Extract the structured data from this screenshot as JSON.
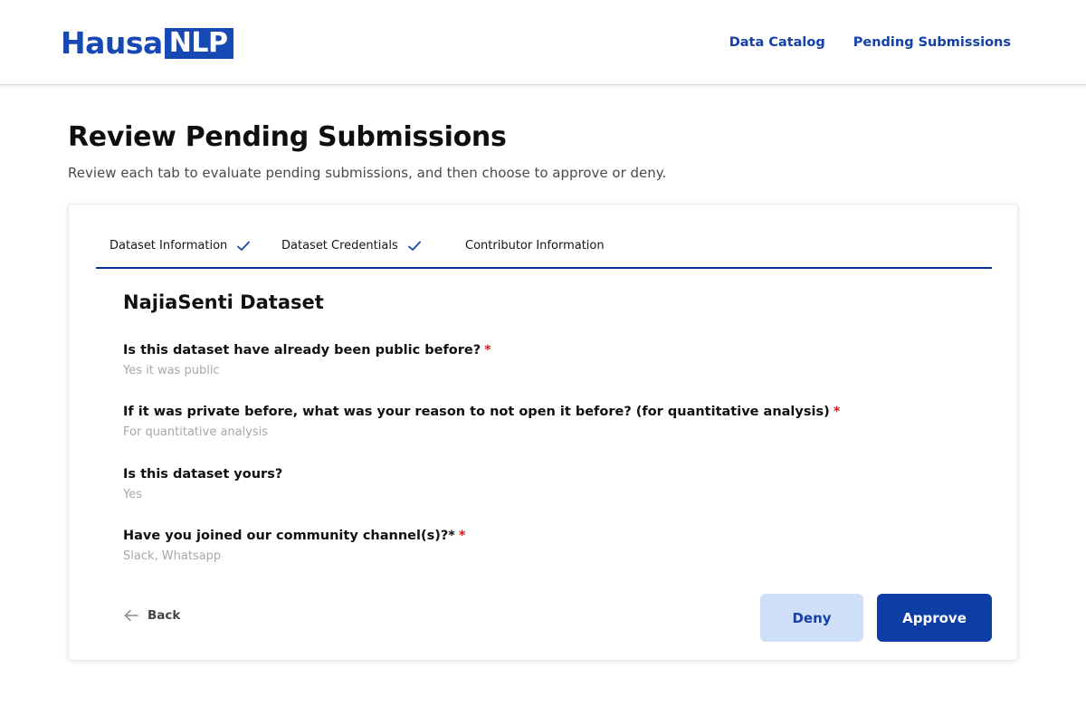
{
  "header": {
    "logo": {
      "part1": "Hausa",
      "part2": "NLP"
    },
    "nav": [
      {
        "label": "Data Catalog"
      },
      {
        "label": "Pending Submissions"
      }
    ]
  },
  "page": {
    "title": "Review Pending Submissions",
    "subtitle": "Review each tab to evaluate pending submissions, and then choose to approve or deny."
  },
  "tabs": [
    {
      "label": "Dataset Information",
      "completed": true,
      "icon": "check-icon"
    },
    {
      "label": "Dataset Credentials",
      "completed": true,
      "icon": "check-icon"
    },
    {
      "label": "Contributor Information",
      "completed": false
    }
  ],
  "form": {
    "dataset_title": "NajiaSenti Dataset",
    "required_mark": "*",
    "questions": [
      {
        "label": "Is this dataset have already been public before?",
        "required": true,
        "answer": "Yes it was public"
      },
      {
        "label": "If it was private before, what was your reason to not open it before? (for quantitative analysis)",
        "required": true,
        "answer": "For quantitative analysis"
      },
      {
        "label": "Is this dataset yours?",
        "required": false,
        "answer": "Yes"
      },
      {
        "label": "Have you joined our community channel(s)?*",
        "required": true,
        "answer": "Slack, Whatsapp"
      }
    ]
  },
  "actions": {
    "back_label": "Back",
    "back_icon": "arrow-left-icon",
    "deny_label": "Deny",
    "approve_label": "Approve"
  },
  "colors": {
    "brand": "#1749b5",
    "primary_button": "#0c3ea6",
    "secondary_button": "#cfdff8",
    "required": "#d11a1a",
    "answer_text": "#a8a8a8"
  }
}
